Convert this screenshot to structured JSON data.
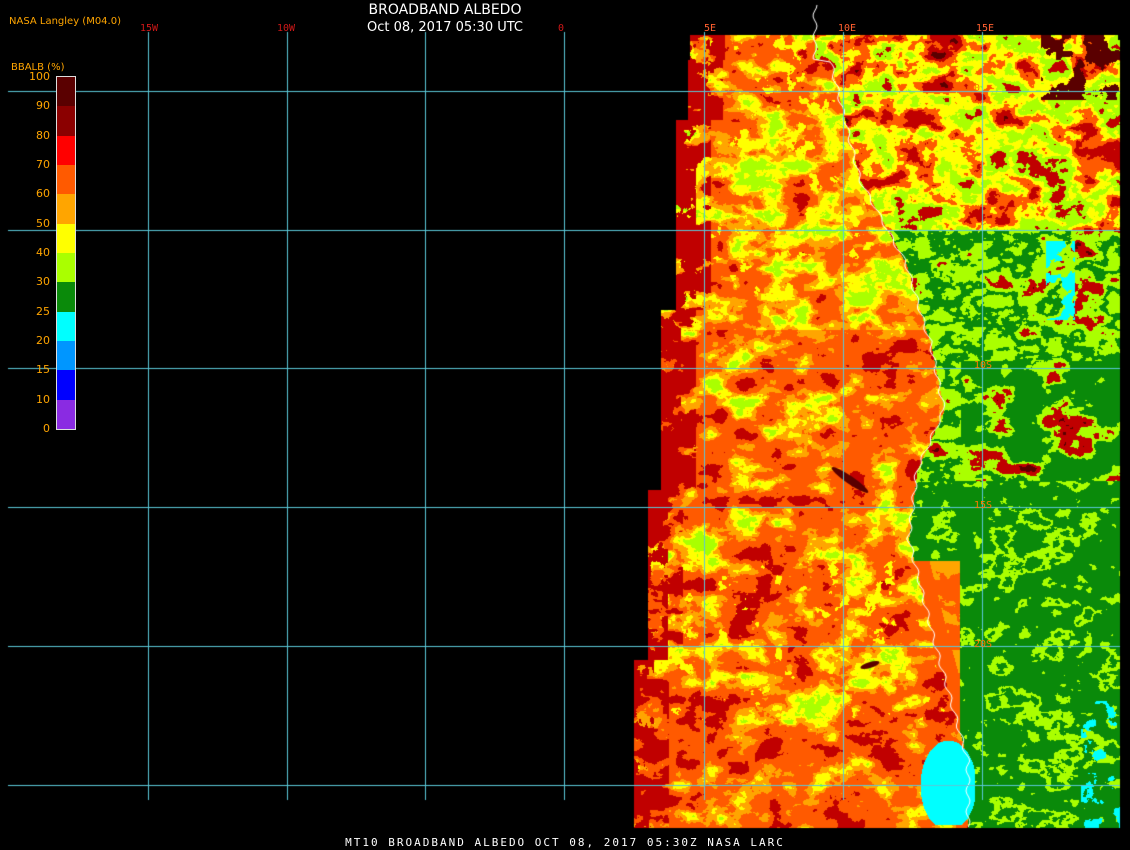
{
  "header": {
    "provider": "NASA Langley (M04.0)",
    "title": "BROADBAND ALBEDO",
    "timestamp": "Oct 08, 2017 05:30 UTC"
  },
  "footer": {
    "text": "MT10  BROADBAND ALBEDO   OCT 08, 2017 05:30Z   NASA LARC"
  },
  "colorbar": {
    "label": "BBALB (%)",
    "ticks": [
      "100",
      "90",
      "80",
      "70",
      "60",
      "50",
      "40",
      "30",
      "25",
      "20",
      "15",
      "10",
      "0"
    ],
    "colors": [
      "#5a0000",
      "#8b0000",
      "#ff0000",
      "#ff5a00",
      "#ffa500",
      "#ffff00",
      "#aaff00",
      "#0a8a0a",
      "#00ffff",
      "#0096ff",
      "#0000ff",
      "#8a2be2"
    ]
  },
  "grid": {
    "lon_labels": [
      "15W",
      "10W",
      "0",
      "5E",
      "10E",
      "15E"
    ],
    "lat_labels": [
      "0",
      "10S",
      "15S",
      "20S"
    ],
    "color": "#5bc8d8"
  },
  "palette": {
    "darkred": "#5a0000",
    "red": "#c00000",
    "orange": "#ff5a00",
    "lightorange": "#ffa500",
    "yellow": "#ffff00",
    "lime": "#aaff00",
    "green": "#0a8a0a",
    "cyan": "#00ffff",
    "coast": "#ffffff"
  }
}
